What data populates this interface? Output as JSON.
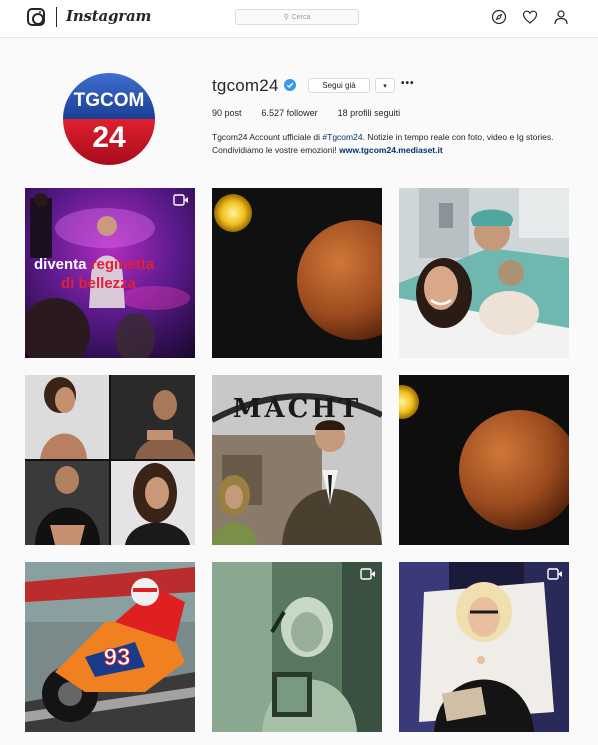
{
  "header": {
    "brand": "Instagram",
    "search_placeholder": "Cerca",
    "icons": [
      "instagram-glyph-icon",
      "compass-icon",
      "heart-icon",
      "user-icon",
      "search-icon"
    ]
  },
  "profile": {
    "username": "tgcom24",
    "verified": true,
    "follow_label": "Segui già",
    "dropdown_glyph": "▾",
    "more_glyph": "•••",
    "avatar_logo_top": "TGCOM",
    "avatar_logo_bottom": "24",
    "stats": {
      "posts_count": "90",
      "posts_label": "post",
      "followers_count": "6.527",
      "followers_label": "follower",
      "following_count": "18",
      "following_label": "profili seguiti"
    },
    "bio": {
      "line_start": "Tgcom24 Account ufficiale di ",
      "hashtag": "#Tgcom24",
      "line_rest": ". Notizie in tempo reale con foto, video e Ig stories. Condividiamo le vostre emozioni! ",
      "link": "www.tgcom24.mediaset.it"
    }
  },
  "posts": [
    {
      "id": "post-1",
      "type": "video",
      "overlay_line1_white": "diventa ",
      "overlay_line1_red": "reginetta",
      "overlay_line2": "di bellezza"
    },
    {
      "id": "post-2",
      "type": "image"
    },
    {
      "id": "post-3",
      "type": "image"
    },
    {
      "id": "post-4",
      "type": "image"
    },
    {
      "id": "post-5",
      "type": "image",
      "sign_text": "MACHT"
    },
    {
      "id": "post-6",
      "type": "image"
    },
    {
      "id": "post-7",
      "type": "image",
      "bike_number": "93"
    },
    {
      "id": "post-8",
      "type": "video"
    },
    {
      "id": "post-9",
      "type": "video"
    }
  ],
  "colors": {
    "accent_link": "#003569",
    "verified_blue": "#3897f0",
    "avatar_red": "#c8102e",
    "avatar_blue": "#1f4fa3"
  }
}
